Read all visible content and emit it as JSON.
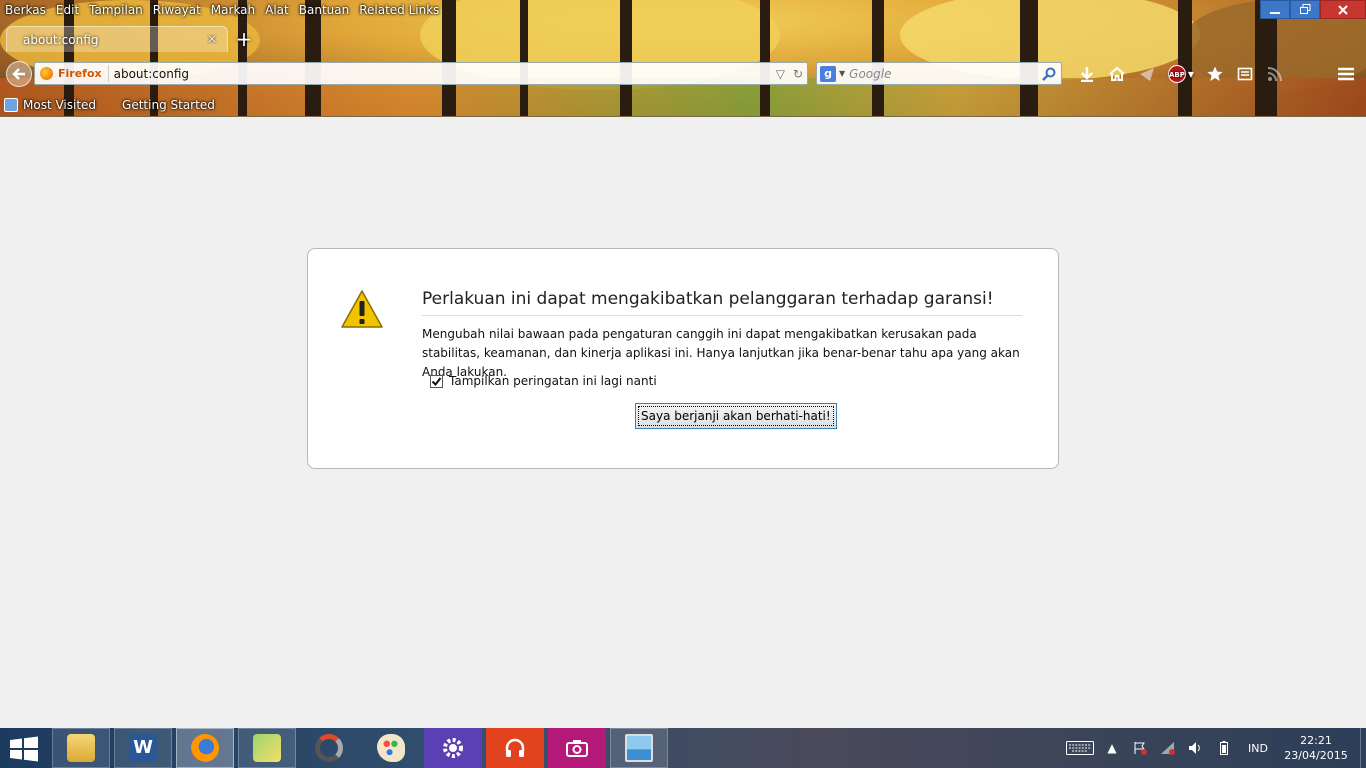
{
  "menubar": [
    "Berkas",
    "Edit",
    "Tampilan",
    "Riwayat",
    "Markah",
    "Alat",
    "Bantuan",
    "Related Links"
  ],
  "tab": {
    "label": "about:config"
  },
  "urlbar": {
    "identity": "Firefox",
    "url": "about:config"
  },
  "searchbar": {
    "engine_letter": "g",
    "placeholder": "Google"
  },
  "bookmarks": [
    "Most Visited",
    "Getting Started"
  ],
  "toolbar_icons": [
    "download-icon",
    "home-icon",
    "send-icon",
    "adblock-plus-icon",
    "star-bookmark-icon",
    "reader-icon",
    "rss-icon",
    "menu-icon"
  ],
  "abp_label": "ABP",
  "warning": {
    "title": "Perlakuan ini dapat mengakibatkan pelanggaran terhadap garansi!",
    "message": "Mengubah nilai bawaan pada pengaturan canggih ini dapat mengakibatkan kerusakan pada stabilitas, keamanan, dan kinerja aplikasi ini. Hanya lanjutkan jika benar-benar tahu apa yang akan Anda lakukan.",
    "checkbox_label": "Tampilkan peringatan ini lagi nanti",
    "checkbox_checked": true,
    "button_label": "Saya berjanji akan berhati-hati!"
  },
  "taskbar": {
    "apps": [
      "file-explorer",
      "word",
      "firefox",
      "file-manager",
      "chrome-like",
      "paint",
      "settings",
      "music",
      "camera",
      "photos"
    ],
    "language": "IND",
    "time": "22:21",
    "date": "23/04/2015"
  },
  "colors": {
    "accent_firefox": "#e66000",
    "dialog_border": "#b8b8b8",
    "warning_yellow": "#f2c400",
    "close_red": "#c7372f",
    "win_blue": "#3c77c9"
  }
}
